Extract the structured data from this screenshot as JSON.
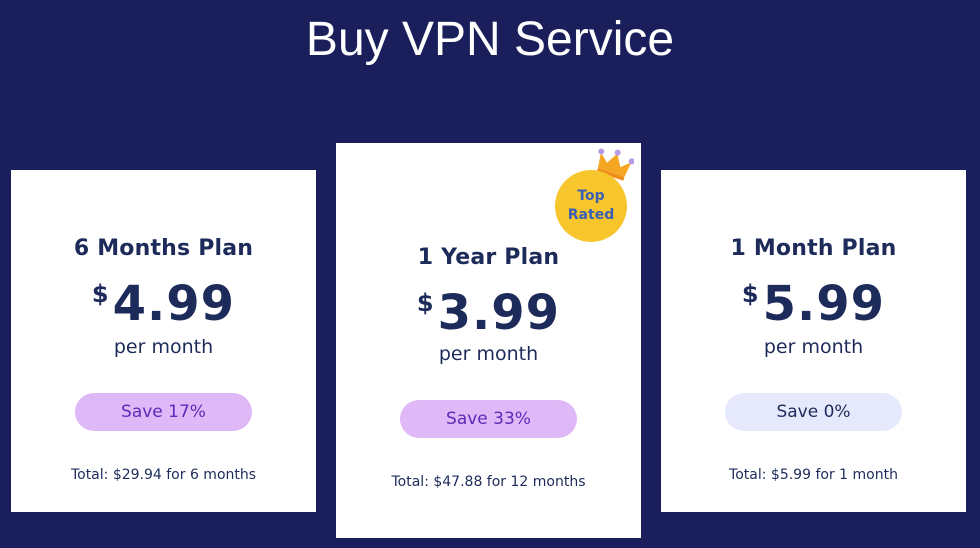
{
  "page": {
    "title": "Buy VPN Service"
  },
  "plans": [
    {
      "name": "6 Months Plan",
      "currency": "$",
      "price": "4.99",
      "period": "per month",
      "save": "Save 17%",
      "total": "Total: $29.94 for 6 months"
    },
    {
      "name": "1 Year Plan",
      "currency": "$",
      "price": "3.99",
      "period": "per month",
      "save": "Save 33%",
      "total": "Total: $47.88 for 12 months",
      "badge_line1": "Top",
      "badge_line2": "Rated",
      "badge_icon": "crown-icon"
    },
    {
      "name": "1 Month Plan",
      "currency": "$",
      "price": "5.99",
      "period": "per month",
      "save": "Save 0%",
      "total": "Total: $5.99 for 1 month"
    }
  ],
  "colors": {
    "background": "#1a1f5c",
    "card": "#ffffff",
    "text": "#1d2b5a",
    "save_purple": "#dfb8f7",
    "save_lavender": "#e6e8fb",
    "badge": "#f7c52c",
    "crown": "#f5a623"
  }
}
